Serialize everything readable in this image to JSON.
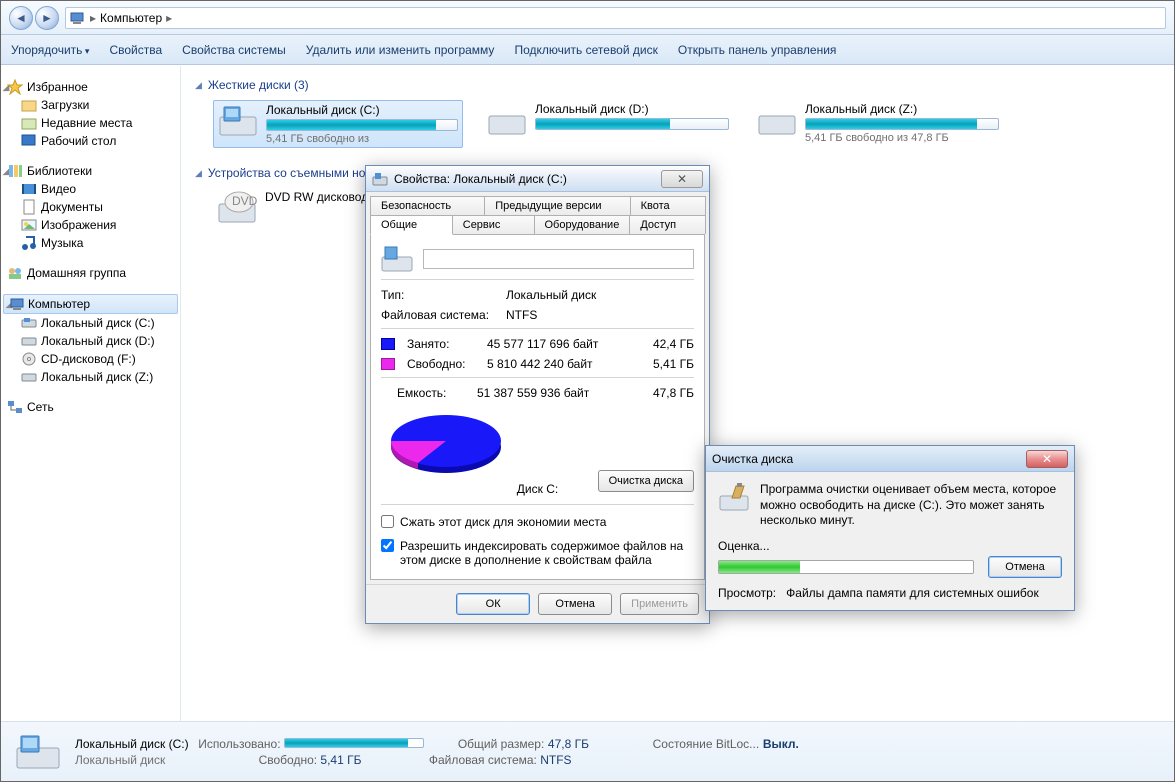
{
  "breadcrumb": {
    "root": "Компьютер"
  },
  "toolbar": {
    "organize": "Упорядочить",
    "properties": "Свойства",
    "sys_properties": "Свойства системы",
    "uninstall": "Удалить или изменить программу",
    "map_drive": "Подключить сетевой диск",
    "control_panel": "Открыть панель управления"
  },
  "sidebar": {
    "favorites": "Избранное",
    "downloads": "Загрузки",
    "recent": "Недавние места",
    "desktop": "Рабочий стол",
    "libraries": "Библиотеки",
    "video": "Видео",
    "documents": "Документы",
    "pictures": "Изображения",
    "music": "Музыка",
    "homegroup": "Домашняя группа",
    "computer": "Компьютер",
    "drive_c": "Локальный диск (C:)",
    "drive_d": "Локальный диск (D:)",
    "cd": "CD-дисковод (F:)",
    "drive_z": "Локальный диск (Z:)",
    "network": "Сеть"
  },
  "sections": {
    "hdd": "Жесткие диски (3)",
    "removable": "Устройства со съемными носителями"
  },
  "drives": {
    "c": {
      "name": "Локальный диск (C:)",
      "free": "5,41 ГБ свободно из",
      "fill": 89
    },
    "d": {
      "name": "Локальный диск (D:)",
      "fill": 70
    },
    "z": {
      "name": "Локальный диск (Z:)",
      "free": "5,41 ГБ свободно из 47,8 ГБ",
      "fill": 89
    },
    "dvd": {
      "name": "DVD RW дисковод (E:)"
    }
  },
  "details": {
    "title": "Локальный диск (C:)",
    "subtitle": "Локальный диск",
    "used_label": "Использовано:",
    "total_label": "Общий размер:",
    "total_val": "47,8 ГБ",
    "bitlocker_label": "Состояние BitLoc...",
    "bitlocker_val": "Выкл.",
    "free_label": "Свободно:",
    "free_val": "5,41 ГБ",
    "fs_label": "Файловая система:",
    "fs_val": "NTFS",
    "fill": 89
  },
  "props": {
    "title": "Свойства: Локальный диск (C:)",
    "tabs": {
      "security": "Безопасность",
      "prev": "Предыдущие версии",
      "quota": "Квота",
      "general": "Общие",
      "tools": "Сервис",
      "hardware": "Оборудование",
      "sharing": "Доступ"
    },
    "type_label": "Тип:",
    "type_val": "Локальный диск",
    "fs_label": "Файловая система:",
    "fs_val": "NTFS",
    "used_label": "Занято:",
    "used_bytes": "45 577 117 696 байт",
    "used_gb": "42,4 ГБ",
    "free_label": "Свободно:",
    "free_bytes": "5 810 442 240 байт",
    "free_gb": "5,41 ГБ",
    "cap_label": "Емкость:",
    "cap_bytes": "51 387 559 936 байт",
    "cap_gb": "47,8 ГБ",
    "disk_label": "Диск C:",
    "cleanup_btn": "Очистка диска",
    "compress": "Сжать этот диск для экономии места",
    "index": "Разрешить индексировать содержимое файлов на этом диске в дополнение к свойствам файла",
    "ok": "ОК",
    "cancel": "Отмена",
    "apply": "Применить"
  },
  "cleanup": {
    "title": "Очистка диска",
    "message": "Программа очистки оценивает объем места, которое можно освободить на диске  (C:). Это может занять несколько минут.",
    "estimating": "Оценка...",
    "cancel": "Отмена",
    "scan_label": "Просмотр:",
    "scan_item": "Файлы дампа памяти для системных ошибок",
    "progress": 32
  },
  "chart_data": {
    "type": "pie",
    "title": "Диск C:",
    "series": [
      {
        "name": "Занято",
        "value": 45577117696,
        "value_gb": 42.4,
        "color": "#1818f8"
      },
      {
        "name": "Свободно",
        "value": 5810442240,
        "value_gb": 5.41,
        "color": "#ec28ec"
      }
    ],
    "total": 51387559936,
    "total_gb": 47.8
  }
}
